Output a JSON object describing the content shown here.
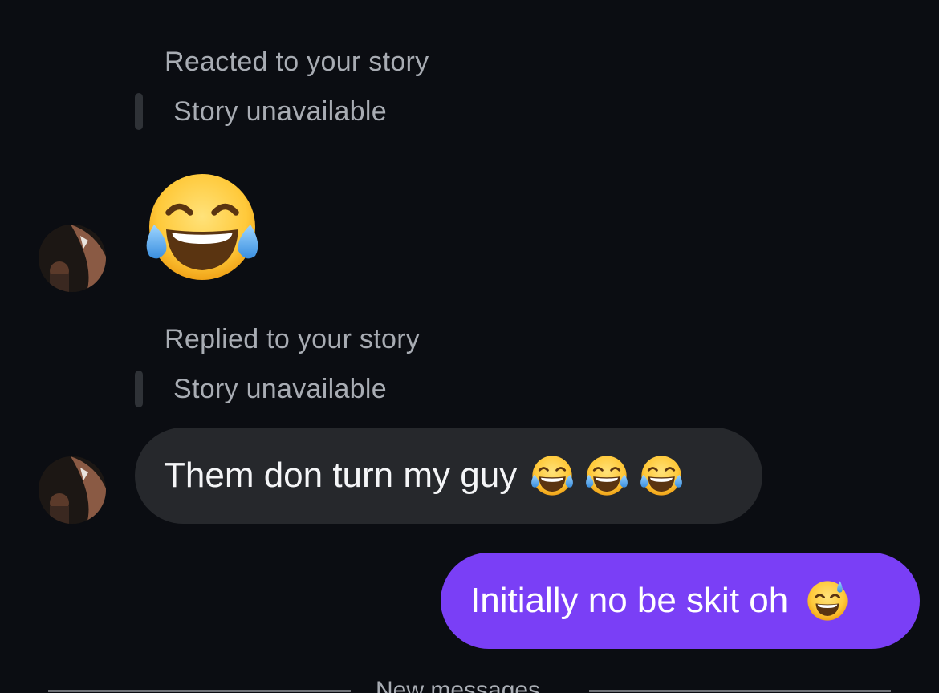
{
  "thread": {
    "first_event": {
      "label": "Reacted to your story",
      "story_ref": "Story unavailable",
      "reaction_emoji": "face-with-tears-of-joy"
    },
    "second_event": {
      "label": "Replied to your story",
      "story_ref": "Story unavailable",
      "message_text": "Them don turn my guy",
      "message_emojis": [
        "face-with-tears-of-joy",
        "face-with-tears-of-joy",
        "face-with-tears-of-joy"
      ]
    },
    "outgoing_message": {
      "text": "Initially no be skit oh",
      "emoji": "grinning-face-with-sweat"
    },
    "divider": {
      "label": "New messages"
    }
  },
  "colors": {
    "background": "#0b0d12",
    "incoming_bubble": "#26282c",
    "outgoing_bubble": "#7a3ff6",
    "muted_text": "#a8acb3",
    "primary_text": "#f4f5f7"
  }
}
